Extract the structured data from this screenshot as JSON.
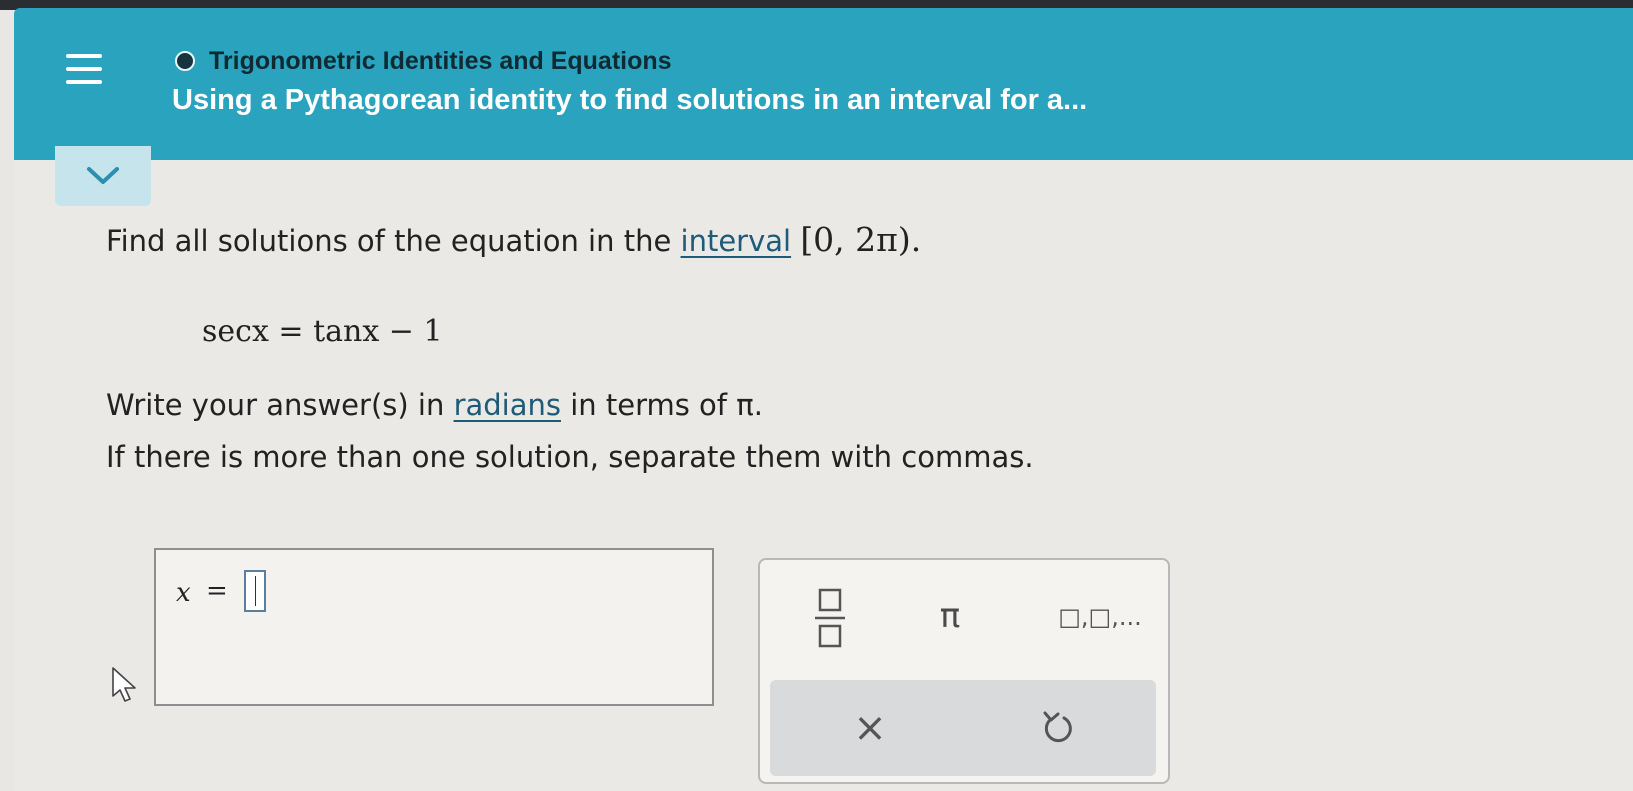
{
  "header": {
    "topic_title": "Trigonometric Identities and Equations",
    "lesson_title": "Using a Pythagorean identity to find solutions in an interval for a..."
  },
  "icons": {
    "menu": "hamburger-menu-icon",
    "collapse": "chevron-down-icon",
    "topic_status": "circle-status-icon",
    "cursor": "mouse-pointer-icon",
    "fraction": "fraction-template-icon",
    "clear": "close-icon",
    "undo": "undo-icon"
  },
  "problem": {
    "prompt_prefix": "Find all solutions of the equation in the ",
    "interval_link": "interval",
    "interval_value": "[0, 2π).",
    "equation": "secx = tanx − 1",
    "instruction1_prefix": "Write your answer(s) in ",
    "radians_link": "radians",
    "instruction1_suffix": " in terms of π.",
    "instruction2": "If there is more than one solution, separate them with commas."
  },
  "answer": {
    "variable": "x",
    "equals": "=",
    "value": ""
  },
  "keypad": {
    "pi_label": "π",
    "list_label": "□,□,...",
    "clear_label": "×"
  },
  "colors": {
    "header_bg": "#2aa3bf",
    "collapse_tab_bg": "#c5e4ec",
    "link": "#1e5b78"
  }
}
